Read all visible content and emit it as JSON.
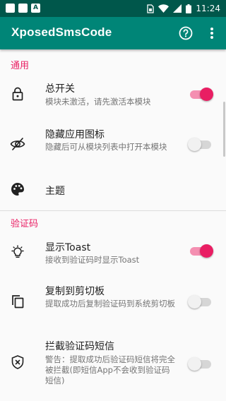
{
  "status_bar": {
    "time": "11:24",
    "notification_icons": [
      "square-icon",
      "square-icon",
      "a-letter-icon"
    ],
    "indicator_icons": [
      "sim-card-icon",
      "wifi-icon",
      "signal-icon",
      "battery-icon"
    ]
  },
  "app_bar": {
    "title": "XposedSmsCode",
    "help_icon": "help-circle-icon",
    "more_icon": "more-vert-icon"
  },
  "sections": {
    "general": {
      "header": "通用",
      "items": {
        "master_switch": {
          "title": "总开关",
          "summary": "模块未激活，请先激活本模块",
          "icon": "lock-icon",
          "checked": true
        },
        "hide_icon": {
          "title": "隐藏应用图标",
          "summary": "隐藏后可从模块列表中打开本模块",
          "icon": "eye-off-icon",
          "checked": false
        },
        "theme": {
          "title": "主题",
          "icon": "palette-icon"
        }
      }
    },
    "verification": {
      "header": "验证码",
      "items": {
        "show_toast": {
          "title": "显示Toast",
          "summary": "接收到验证码时显示Toast",
          "icon": "lightbulb-icon",
          "checked": true
        },
        "copy_clipboard": {
          "title": "复制到剪切板",
          "summary": "提取成功后复制验证码到系统剪切板",
          "icon": "copy-icon",
          "checked": false
        },
        "block_sms": {
          "title": "拦截验证码短信",
          "summary": "警告：提取成功后验证码短信将完全被拦截(即短信App不会收到验证码短信)",
          "icon": "shield-x-icon",
          "checked": false
        }
      }
    }
  },
  "colors": {
    "status_bar": "#00574b",
    "app_bar": "#008577",
    "accent": "#e91e63"
  }
}
